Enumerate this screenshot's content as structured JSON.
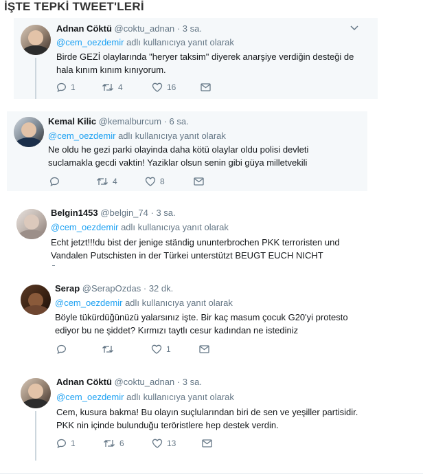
{
  "page": {
    "heading": "İŞTE TEPKİ TWEET'LERİ"
  },
  "reply_prefix": "adlı kullanıcıya yanıt olarak",
  "tweets": [
    {
      "name": "Adnan Cöktü",
      "handle": "@coktu_adnan",
      "dot": "·",
      "time": "3 sa.",
      "mention": "@cem_oezdemir",
      "text": "Birde GEZİ olaylarında \"heryer taksim\" diyerek anarşiye verdiğin desteği de hala kınım kınım kınıyorum.",
      "replies": "1",
      "retweets": "4",
      "likes": "16"
    },
    {
      "name": "Kemal Kilic",
      "handle": "@kemalburcum",
      "dot": "·",
      "time": "6 sa.",
      "mention": "@cem_oezdemir",
      "text": "Ne oldu he gezi parki olayinda daha kötü olaylar oldu polisi devleti suclamakla gecdi vaktin! Yaziklar olsun senin gibi güya milletvekili",
      "replies": "",
      "retweets": "4",
      "likes": "8"
    },
    {
      "name": "Belgin1453",
      "handle": "@belgin_74",
      "dot": "·",
      "time": "3 sa.",
      "mention": "@cem_oezdemir",
      "text": "Echt jetzt!!!du bist der jenige ständig ununterbrochen PKK terroristen und Vandalen Putschisten in der Türkei unterstützt BEUGT EUCH NICHT",
      "replies": "",
      "retweets": "",
      "likes": ""
    },
    {
      "name": "Serap",
      "handle": "@SerapOzdas",
      "dot": "·",
      "time": "32 dk.",
      "mention": "@cem_oezdemir",
      "text": "Böyle tükürdüğünüzü yalarsınız işte. Bir kaç masum çocuk G20'yi protesto ediyor bu ne şiddet? Kırmızı taytlı cesur kadından ne istediniz",
      "replies": "",
      "retweets": "",
      "likes": "1"
    },
    {
      "name": "Adnan Cöktü",
      "handle": "@coktu_adnan",
      "dot": "·",
      "time": "3 sa.",
      "mention": "@cem_oezdemir",
      "text": "Cem, kusura bakma! Bu olayın suçlularından biri de sen ve yeşiller partisidir. PKK nin içinde bulunduğu teröristlere hep destek verdin.",
      "replies": "1",
      "retweets": "6",
      "likes": "13"
    }
  ],
  "icons": {
    "reply": "reply-icon",
    "retweet": "retweet-icon",
    "like": "heart-icon",
    "dm": "envelope-icon",
    "more": "chevron-down-icon"
  },
  "colors": {
    "accent": "#1da1f2",
    "muted": "#657786",
    "card_bg": "#f5f8fa"
  }
}
